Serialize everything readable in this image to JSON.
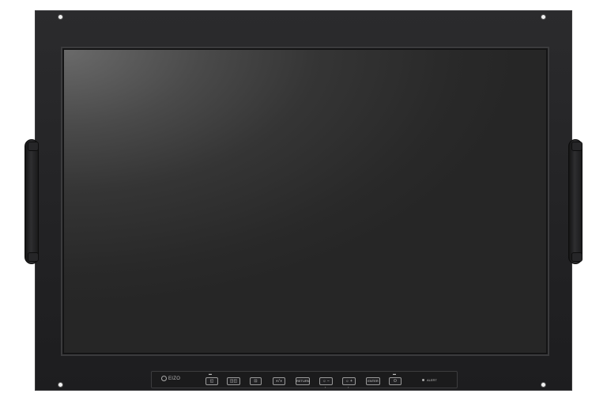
{
  "panel": {
    "logo_text": "EIZO",
    "buttons": [
      {
        "label": "◱",
        "icon": "input-source-icon"
      },
      {
        "label": "◫◫",
        "icon": "picture-in-picture-icon"
      },
      {
        "label": "⊡",
        "icon": "screen-size-icon"
      },
      {
        "label": "◐/◑",
        "icon": "mode-icon"
      },
      {
        "label": "RETURN",
        "icon": ""
      },
      {
        "label": "☼ −",
        "icon": "brightness-down-icon"
      },
      {
        "label": "☼ +",
        "icon": "brightness-up-icon"
      },
      {
        "label": "ENTER",
        "icon": ""
      },
      {
        "label": "⏻",
        "icon": "power-icon"
      }
    ],
    "alert_label": "ALERT"
  },
  "colors": {
    "bezel": "#242426",
    "screen": "#333333",
    "panel": "#1b1b1c"
  }
}
